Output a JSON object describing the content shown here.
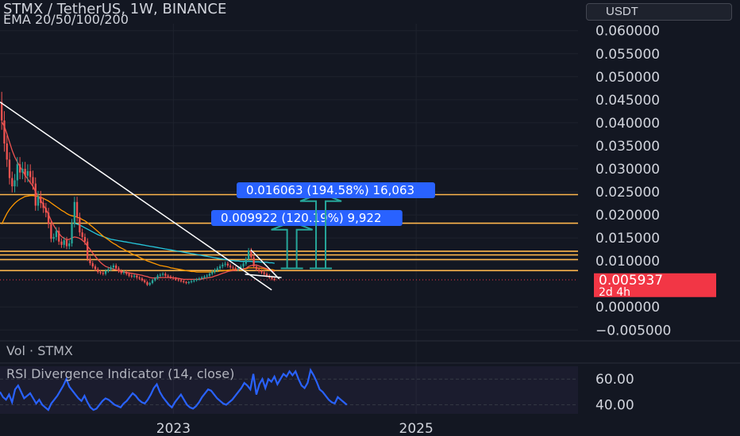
{
  "header": {
    "title": "STMX / TetherUS, 1W, BINANCE",
    "indicator": "EMA 20/50/100/200",
    "currency": "USDT"
  },
  "colors": {
    "background": "#131722",
    "grid": "#1e222d",
    "axis_text": "#d1d4dc",
    "candle_up": "#26a69a",
    "candle_down": "#ef5350",
    "level_line": "#ffb74d",
    "trendline": "#ffffff",
    "ema20": "#ef5350",
    "ema50": "#ff9800",
    "ema100": "#26c6da",
    "target_arrow": "#26a69a",
    "label_box": "#2962ff",
    "price_tag": "#f23645",
    "rsi_line": "#2962ff"
  },
  "chart_data": {
    "type": "candlestick",
    "price_axis": {
      "ylim": [
        -0.0065,
        0.0615
      ],
      "ticks": [
        "0.060000",
        "0.055000",
        "0.050000",
        "0.045000",
        "0.040000",
        "0.035000",
        "0.030000",
        "0.025000",
        "0.020000",
        "0.015000",
        "0.010000",
        "0.000000",
        "−0.005000"
      ]
    },
    "time_axis": {
      "ticks": [
        "2023",
        "2025"
      ],
      "tick_t": [
        0.3,
        0.72
      ]
    },
    "price_tag": {
      "value": 0.005937,
      "text": "0.005937",
      "countdown": "2d 4h"
    },
    "horizontal_levels": [
      0.0244,
      0.0182,
      0.0121,
      0.0113,
      0.0103,
      0.0079
    ],
    "dotted_level": 0.0059,
    "trendlines": [
      {
        "from": [
          0.0,
          0.0445
        ],
        "to": [
          0.47,
          0.0037
        ]
      },
      {
        "from": [
          0.434,
          0.0124
        ],
        "to": [
          0.483,
          0.0061
        ]
      },
      {
        "from": [
          0.424,
          0.0071
        ],
        "to": [
          0.487,
          0.0064
        ]
      }
    ],
    "targets": [
      {
        "t": 0.505,
        "base": 0.0084,
        "top": 0.0185,
        "label": "0.009922 (120.19%) 9,922"
      },
      {
        "t": 0.555,
        "base": 0.0084,
        "top": 0.0247,
        "label": "0.016063 (194.58%) 16,063"
      }
    ],
    "candles_close": [
      0.0405,
      0.0355,
      0.032,
      0.028,
      0.0262,
      0.0275,
      0.031,
      0.0292,
      0.03,
      0.0285,
      0.0295,
      0.0282,
      0.0268,
      0.022,
      0.024,
      0.0226,
      0.0215,
      0.0205,
      0.018,
      0.0148,
      0.0152,
      0.0165,
      0.0142,
      0.0135,
      0.0145,
      0.0132,
      0.0138,
      0.0182,
      0.0228,
      0.0195,
      0.0162,
      0.0152,
      0.0142,
      0.0105,
      0.0095,
      0.0088,
      0.0082,
      0.0076,
      0.0074,
      0.0072,
      0.0078,
      0.0082,
      0.0086,
      0.009,
      0.0084,
      0.0078,
      0.0074,
      0.0076,
      0.0072,
      0.0068,
      0.0066,
      0.0068,
      0.0064,
      0.0062,
      0.0058,
      0.0054,
      0.0048,
      0.0052,
      0.0058,
      0.0062,
      0.0068,
      0.007,
      0.0072,
      0.0068,
      0.0066,
      0.0064,
      0.0062,
      0.006,
      0.0058,
      0.0056,
      0.0054,
      0.0052,
      0.0054,
      0.0056,
      0.0058,
      0.006,
      0.0062,
      0.0064,
      0.0066,
      0.0068,
      0.0072,
      0.0076,
      0.008,
      0.0084,
      0.0088,
      0.0092,
      0.0094,
      0.009,
      0.0086,
      0.0084,
      0.0082,
      0.0084,
      0.0088,
      0.0094,
      0.0104,
      0.0122,
      0.0108,
      0.0088,
      0.0082,
      0.0078,
      0.0075,
      0.0072,
      0.0068,
      0.0064,
      0.0061,
      0.0059
    ],
    "ema20": [
      0.0402,
      0.0392,
      0.0376,
      0.0358,
      0.034,
      0.0326,
      0.0315,
      0.0305,
      0.0296,
      0.0286,
      0.0278,
      0.027,
      0.0262,
      0.025,
      0.0241,
      0.0232,
      0.0222,
      0.0212,
      0.0201,
      0.0188,
      0.0177,
      0.0168,
      0.016,
      0.0153,
      0.0149,
      0.0146,
      0.0147,
      0.015,
      0.0152,
      0.0151,
      0.0149,
      0.0145,
      0.014,
      0.0132,
      0.0125,
      0.0117,
      0.011,
      0.0103,
      0.0097,
      0.0092,
      0.0088,
      0.0086,
      0.0084,
      0.0082,
      0.0081,
      0.0079,
      0.0077,
      0.0076,
      0.0075,
      0.0074,
      0.0073,
      0.0072,
      0.0071,
      0.007,
      0.0069,
      0.0067,
      0.0066,
      0.0064,
      0.0063,
      0.0063,
      0.0063,
      0.0064,
      0.0064,
      0.0064,
      0.0064,
      0.0064,
      0.0063,
      0.0063,
      0.0062,
      0.0061,
      0.006,
      0.006,
      0.006,
      0.006,
      0.006,
      0.006,
      0.006,
      0.0061,
      0.0062,
      0.0063,
      0.0064,
      0.0065,
      0.0067,
      0.0069,
      0.0071,
      0.0073,
      0.0075,
      0.0077,
      0.0078,
      0.0079,
      0.008,
      0.0081,
      0.0082,
      0.0083,
      0.0084,
      0.0088,
      0.009,
      0.0091,
      0.0091,
      0.0089,
      0.0087,
      0.0085,
      0.0083,
      0.0081,
      0.0079,
      0.0077
    ],
    "ema50": [
      0.018,
      0.0192,
      0.0203,
      0.0212,
      0.0219,
      0.0225,
      0.023,
      0.0234,
      0.0237,
      0.024,
      0.0241,
      0.0242,
      0.0242,
      0.0241,
      0.024,
      0.0238,
      0.0236,
      0.0233,
      0.023,
      0.0226,
      0.0222,
      0.0218,
      0.0214,
      0.021,
      0.0207,
      0.0203,
      0.02,
      0.0198,
      0.0197,
      0.0195,
      0.0193,
      0.019,
      0.0187,
      0.0183,
      0.0178,
      0.0174,
      0.0169,
      0.0164,
      0.0159,
      0.0154,
      0.015,
      0.0146,
      0.0142,
      0.0138,
      0.0135,
      0.0131,
      0.0128,
      0.0125,
      0.0122,
      0.0119,
      0.0116,
      0.0113,
      0.0111,
      0.0108,
      0.0105,
      0.0103,
      0.01,
      0.0098,
      0.0096,
      0.0094,
      0.0092,
      0.009,
      0.0089,
      0.0088,
      0.0087,
      0.0085,
      0.0084,
      0.0083,
      0.0082,
      0.0081,
      0.008,
      0.0079,
      0.0078,
      0.0077,
      0.0077,
      0.0076,
      0.0076,
      0.0076,
      0.0076,
      0.0076,
      0.0076,
      0.0076,
      0.0077,
      0.0077,
      0.0078,
      0.0078,
      0.0079,
      0.008,
      0.008,
      0.0081,
      0.0081,
      0.0081,
      0.0082,
      0.0082,
      0.0083,
      0.0085,
      0.0085,
      0.0085,
      0.0085,
      0.0084,
      0.0084,
      0.0083,
      0.0082,
      0.0081,
      0.0081,
      0.008
    ],
    "ema100": [
      null,
      null,
      null,
      null,
      null,
      null,
      null,
      null,
      null,
      null,
      null,
      null,
      null,
      null,
      null,
      null,
      null,
      null,
      null,
      null,
      null,
      null,
      null,
      null,
      null,
      null,
      null,
      null,
      0.0182,
      0.018,
      0.0178,
      0.0175,
      0.0172,
      0.0169,
      0.0166,
      0.0163,
      0.016,
      0.0157,
      0.0155,
      0.0153,
      0.0151,
      0.0149,
      0.0147,
      0.0146,
      0.0145,
      0.0144,
      0.0143,
      0.0142,
      0.0141,
      0.014,
      0.0139,
      0.0138,
      0.0137,
      0.0136,
      0.0135,
      0.0134,
      0.0133,
      0.0132,
      0.0131,
      0.013,
      0.0129,
      0.0128,
      0.0127,
      0.0126,
      0.0125,
      0.0124,
      0.0123,
      0.0122,
      0.0121,
      0.012,
      0.0119,
      0.0118,
      0.0117,
      0.0116,
      0.0115,
      0.0114,
      0.0113,
      0.0112,
      0.0111,
      0.011,
      0.0109,
      0.0108,
      0.0107,
      0.0106,
      0.0105,
      0.0104,
      0.0103,
      0.0102,
      0.0101,
      0.0101,
      0.01,
      0.01,
      0.0099,
      0.0099,
      0.0099,
      0.0099,
      0.0099,
      0.0098,
      0.0098,
      0.0098,
      0.0097,
      0.0097,
      0.0097,
      0.0096,
      0.0096,
      0.0095
    ],
    "volume_pane": {
      "label": "Vol · STMX"
    },
    "rsi_pane": {
      "label": "RSI Divergence Indicator (14, close)",
      "ticks": [
        60,
        40
      ],
      "tick_labels": [
        "60.00",
        "40.00"
      ],
      "ylim": [
        33,
        70
      ],
      "values": [
        50,
        46,
        44,
        48,
        42,
        52,
        55,
        50,
        45,
        47,
        49,
        45,
        41,
        44,
        40,
        38,
        36,
        41,
        44,
        47,
        51,
        55,
        60,
        54,
        51,
        48,
        45,
        43,
        47,
        42,
        38,
        36,
        37,
        40,
        43,
        45,
        44,
        42,
        40,
        39,
        38,
        41,
        43,
        46,
        49,
        47,
        44,
        42,
        41,
        44,
        48,
        53,
        56,
        50,
        46,
        43,
        40,
        38,
        42,
        45,
        48,
        44,
        40,
        38,
        37,
        39,
        42,
        46,
        49,
        52,
        51,
        48,
        45,
        43,
        41,
        40,
        42,
        44,
        47,
        50,
        53,
        57,
        55,
        52,
        64,
        48,
        56,
        60,
        53,
        60,
        58,
        62,
        56,
        60,
        64,
        62,
        66,
        63,
        66,
        60,
        55,
        53,
        57,
        67,
        63,
        58,
        52,
        50,
        47,
        44,
        42,
        41,
        46,
        44,
        42,
        40
      ]
    }
  }
}
